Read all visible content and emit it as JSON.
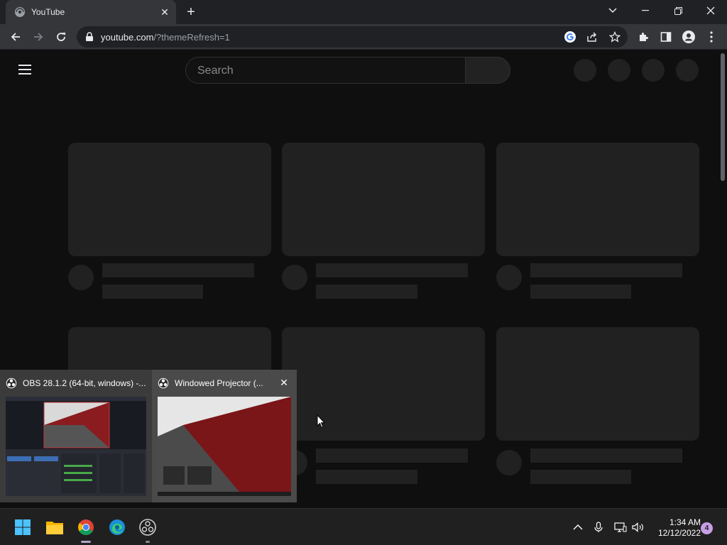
{
  "browser": {
    "tab": {
      "title": "YouTube"
    },
    "address": {
      "host": "youtube.com",
      "path": "/?themeRefresh=1"
    }
  },
  "youtube": {
    "search_placeholder": "Search"
  },
  "task_previews": [
    {
      "title": "OBS 28.1.2 (64-bit, windows) -..."
    },
    {
      "title": "Windowed Projector (..."
    }
  ],
  "taskbar": {
    "apps": [
      "start-button",
      "file-explorer",
      "chrome",
      "edge",
      "obs-studio"
    ],
    "time": "1:34 AM",
    "date": "12/12/2022",
    "notification_count": "4"
  },
  "colors": {
    "chrome_frame": "#202124",
    "chrome_toolbar": "#35363a",
    "youtube_bg": "#0f0f0f",
    "skeleton": "#212121",
    "taskbar": "#202020",
    "windows_accent": "#4cc2ff"
  }
}
